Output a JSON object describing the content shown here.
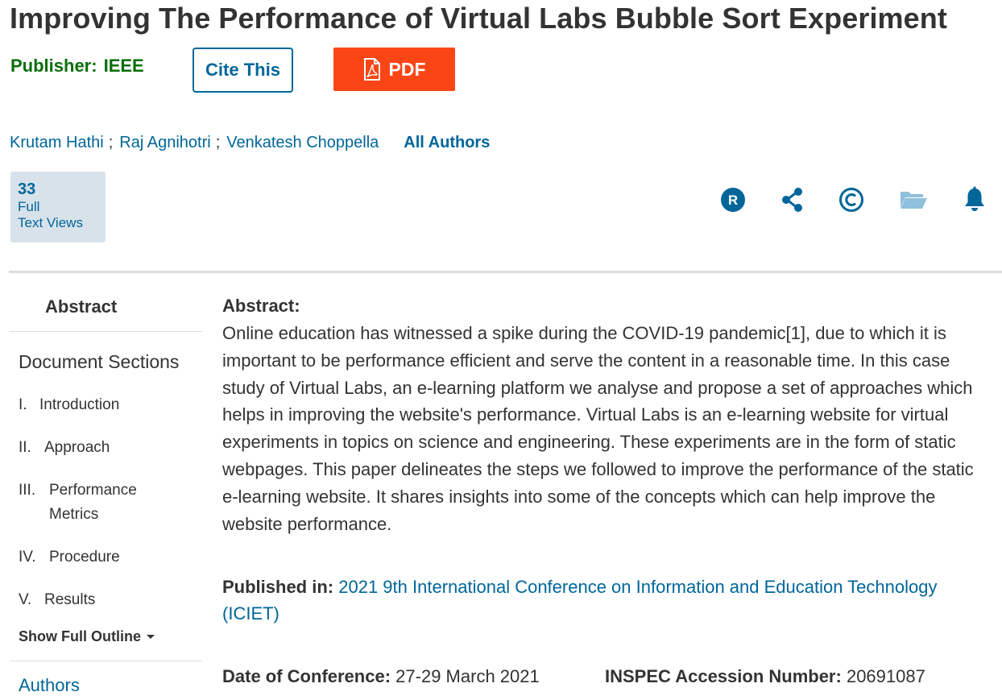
{
  "document": {
    "title": "Improving The Performance of Virtual Labs Bubble Sort Experiment",
    "publisher_label": "Publisher:",
    "publisher_value": "IEEE",
    "cite_label": "Cite This",
    "pdf_label": "PDF"
  },
  "authors": {
    "names": [
      "Krutam Hathi",
      "Raj Agnihotri",
      "Venkatesh Choppella"
    ],
    "separator": ";",
    "all_label": "All Authors"
  },
  "metrics": {
    "count": "33",
    "label_line1": "Full",
    "label_line2": "Text Views"
  },
  "icons": [
    "rights-permissions-icon",
    "share-icon",
    "copyright-icon",
    "folder-icon",
    "bell-icon"
  ],
  "sidebar": {
    "abstract": "Abstract",
    "sections_title": "Document Sections",
    "items": [
      {
        "num": "I.",
        "label": "Introduction"
      },
      {
        "num": "II.",
        "label": "Approach"
      },
      {
        "num": "III.",
        "label": "Performance Metrics"
      },
      {
        "num": "IV.",
        "label": "Procedure"
      },
      {
        "num": "V.",
        "label": "Results"
      }
    ],
    "show_outline": "Show Full Outline",
    "authors": "Authors"
  },
  "abstract": {
    "heading": "Abstract:",
    "text": "Online education has witnessed a spike during the COVID-19 pandemic[1], due to which it is important to be performance efficient and serve the content in a reasonable time. In this case study of Virtual Labs, an e-learning platform we analyse and propose a set of approaches which helps in improving the website's performance. Virtual Labs is an e-learning website for virtual experiments in topics on science and engineering. These experiments are in the form of static webpages. This paper delineates the steps we followed to improve the performance of the static e-learning website. It shares insights into some of the concepts which can help improve the website performance."
  },
  "published": {
    "label": "Published in:",
    "conference": "2021 9th International Conference on Information and Education Technology (ICIET)"
  },
  "meta": {
    "date_label": "Date of Conference:",
    "date_value": "27-29 March 2021",
    "inspec_label": "INSPEC Accession Number:",
    "inspec_value": "20691087"
  },
  "colors": {
    "link": "#006699",
    "publisher": "#0a6e0a",
    "pdf": "#fa4616",
    "metric_bg": "#d7e2ea"
  }
}
